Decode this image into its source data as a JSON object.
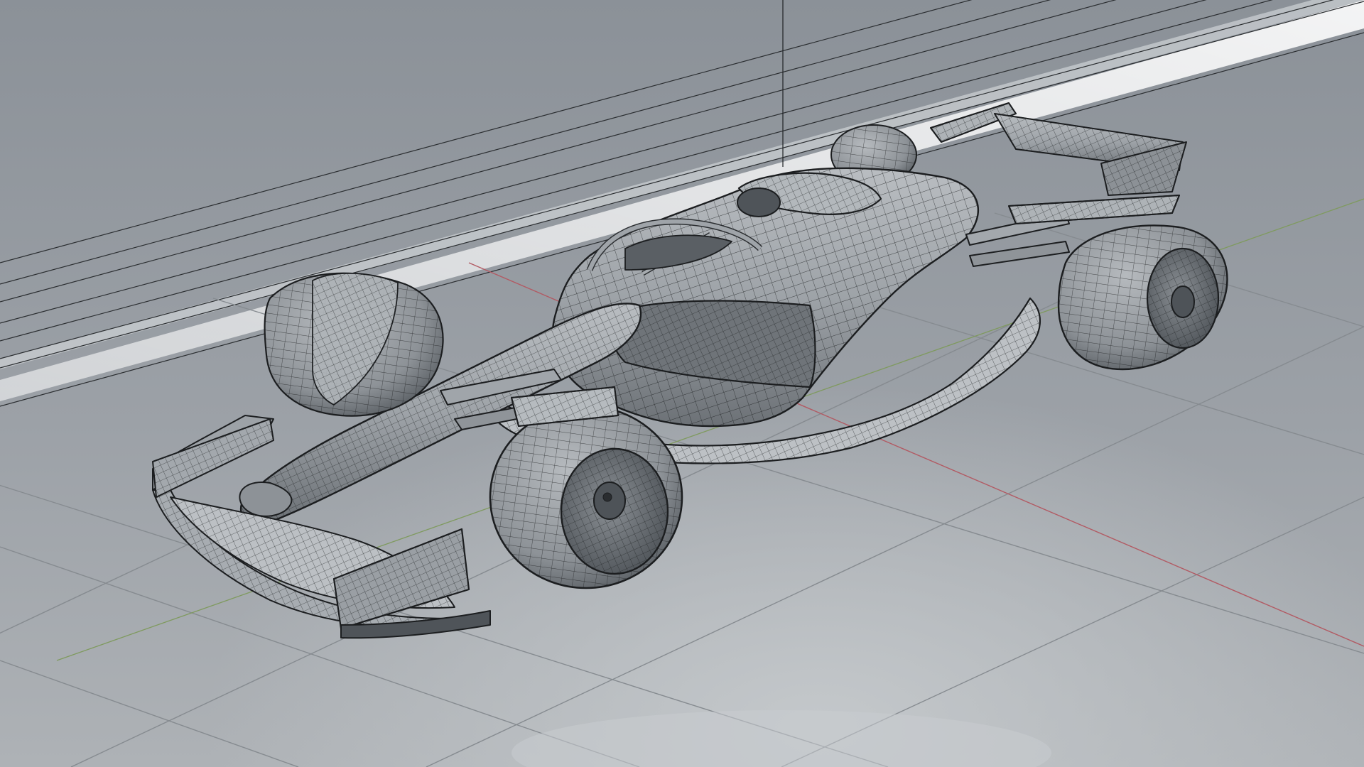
{
  "viewport": {
    "kind": "3d-modeling-viewport",
    "mode": "wireframe-on-shaded",
    "subject": "formula-one-car-model",
    "colors": {
      "background_top": "#8e949b",
      "background_floor": "#a3a8ad",
      "grid_line": "#8a8f94",
      "x_axis": "#b25a63",
      "y_axis": "#7f9a5e",
      "wire": "#1c1e20",
      "surface": "#9a9fa4",
      "surface_light": "#c9cdd0",
      "surface_dark": "#5e6368"
    }
  }
}
